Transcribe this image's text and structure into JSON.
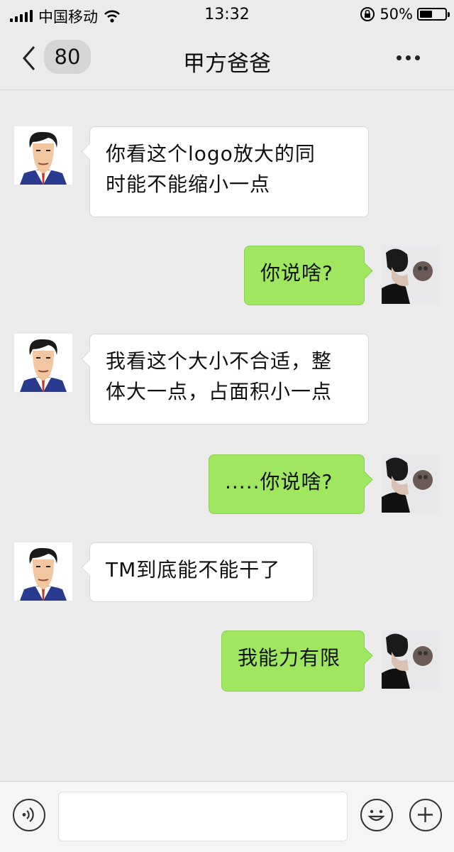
{
  "status_bar": {
    "carrier": "中国移动",
    "time": "13:32",
    "battery_percent": "50%",
    "battery_level": 0.5
  },
  "nav": {
    "unread_count": "80",
    "title": "甲方爸爸"
  },
  "messages": [
    {
      "side": "in",
      "line1": "你看这个logo放大的同",
      "line2": "时能不能缩小一点"
    },
    {
      "side": "out",
      "text": "你说啥?"
    },
    {
      "side": "in",
      "line1": "我看这个大小不合适，整",
      "line2": "体大一点，占面积小一点"
    },
    {
      "side": "out",
      "text": ".....你说啥?"
    },
    {
      "side": "in",
      "text": "TM到底能不能干了"
    },
    {
      "side": "out",
      "text": "我能力有限"
    }
  ],
  "input": {
    "value": "",
    "voice_icon": "voice-icon",
    "emoji_icon": "emoji-icon",
    "plus_icon": "plus-icon"
  },
  "colors": {
    "background": "#ebebeb",
    "outgoing_bubble": "#9ee75f",
    "incoming_bubble": "#ffffff"
  }
}
